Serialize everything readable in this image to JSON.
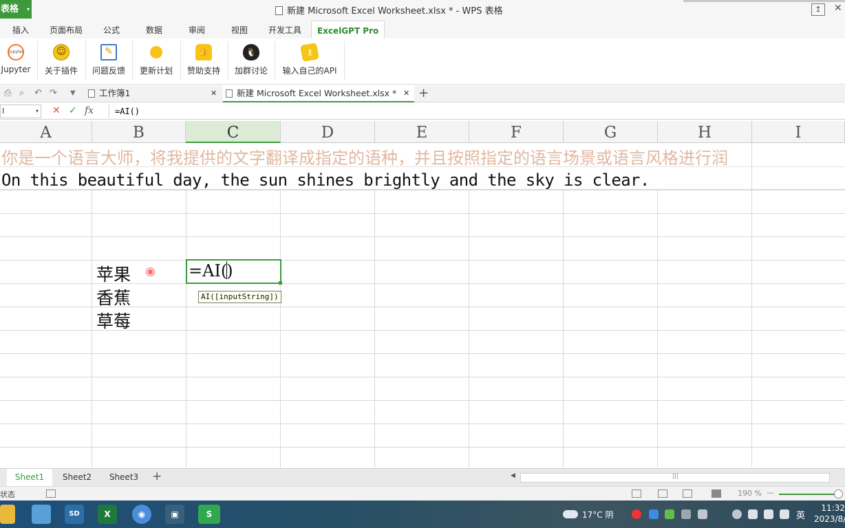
{
  "window": {
    "app_menu": "表格",
    "title": "新建 Microsoft Excel Worksheet.xlsx * - WPS 表格"
  },
  "ribbon_tabs": [
    "插入",
    "页面布局",
    "公式",
    "数据",
    "审阅",
    "视图",
    "开发工具",
    "ExcelGPT Pro"
  ],
  "ribbon_buttons": [
    {
      "label": "Jupyter",
      "icon": "jupyter-icon",
      "icon_text": "jupyter"
    },
    {
      "label": "关于插件",
      "icon": "smile-icon",
      "icon_text": "☺"
    },
    {
      "label": "问题反馈",
      "icon": "edit-icon",
      "icon_text": "✎"
    },
    {
      "label": "更新计划",
      "icon": "yellow-dot-icon",
      "icon_text": ""
    },
    {
      "label": "赞助支持",
      "icon": "thumbs-up-icon",
      "icon_text": "👍"
    },
    {
      "label": "加群讨论",
      "icon": "qq-penguin-icon",
      "icon_text": "🐧"
    },
    {
      "label": "输入自己的API",
      "icon": "api-key-icon",
      "icon_text": "⚷"
    }
  ],
  "doc_tabs": [
    {
      "label": "工作簿1"
    },
    {
      "label": "新建 Microsoft Excel Worksheet.xlsx *"
    }
  ],
  "formula_bar": {
    "name_box": "I",
    "fx_label": "fx",
    "cancel_glyph": "✕",
    "confirm_glyph": "✓",
    "value": "=AI()"
  },
  "columns": [
    "A",
    "B",
    "C",
    "D",
    "E",
    "F",
    "G",
    "H",
    "I"
  ],
  "cells": {
    "row1": "你是一个语言大师，将我提供的文字翻译成指定的语种，并且按照指定的语言场景或语言风格进行润",
    "row2": "On this beautiful day, the sun shines brightly and the sky is clear.",
    "b6": "苹果",
    "b7": "香蕉",
    "b8": "草莓",
    "editor_prefix": "=AI(",
    "editor_suffix": ")",
    "tooltip": "AI([inputString])"
  },
  "sheets": [
    "Sheet1",
    "Sheet2",
    "Sheet3"
  ],
  "status": {
    "text": "状态",
    "zoom": "190 %",
    "zoom_minus": "—"
  },
  "taskbar": {
    "weather": "17°C 阴",
    "lang": "英",
    "time": "11:32",
    "date": "2023/8/"
  },
  "colors": {
    "accent_green": "#3d9a3a",
    "prompt_text": "#e0b8a0"
  }
}
